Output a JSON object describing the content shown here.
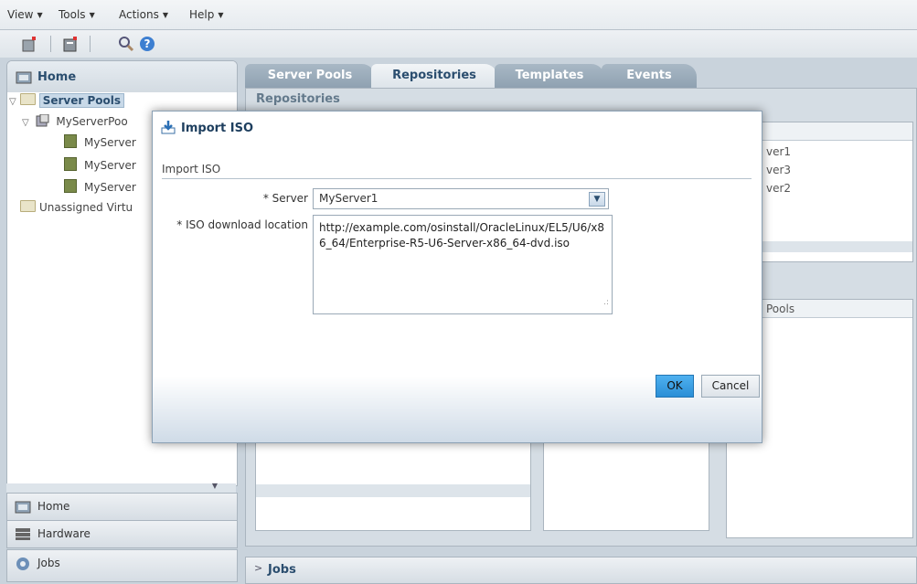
{
  "menu": [
    {
      "label": "View"
    },
    {
      "label": "Tools"
    },
    {
      "label": "Actions"
    },
    {
      "label": "Help"
    }
  ],
  "toolbar": {
    "icons": [
      "server-icon",
      "deploy-icon",
      "search-icon",
      "help-icon"
    ]
  },
  "navigator": {
    "title": "Home",
    "tree": {
      "root": "Server Pools",
      "pool": "MyServerPoo",
      "servers": [
        "MyServer",
        "MyServer",
        "MyServer"
      ],
      "unassigned": "Unassigned Virtu"
    }
  },
  "accordion": {
    "home": "Home",
    "hardware": "Hardware",
    "jobs": "Jobs"
  },
  "tabs": [
    "Server Pools",
    "Repositories",
    "Templates",
    "Events"
  ],
  "content": {
    "subtitle": "Repositories",
    "bg_items": [
      "ver1",
      "ver3",
      "ver2"
    ],
    "bg_pools": "Pools"
  },
  "jobs_bar": {
    "label": "Jobs"
  },
  "dialog": {
    "title": "Import ISO",
    "section": "Import ISO",
    "server_label": "Server",
    "server_value": "MyServer1",
    "location_label": "ISO download location",
    "location_value": "http://example.com/osinstall/OracleLinux/EL5/U6/x86_64/Enterprise-R5-U6-Server-x86_64-dvd.iso",
    "ok": "OK",
    "cancel": "Cancel"
  },
  "colors": {
    "accent": "#2a8ed6",
    "nav_title": "#2b4e6f"
  }
}
